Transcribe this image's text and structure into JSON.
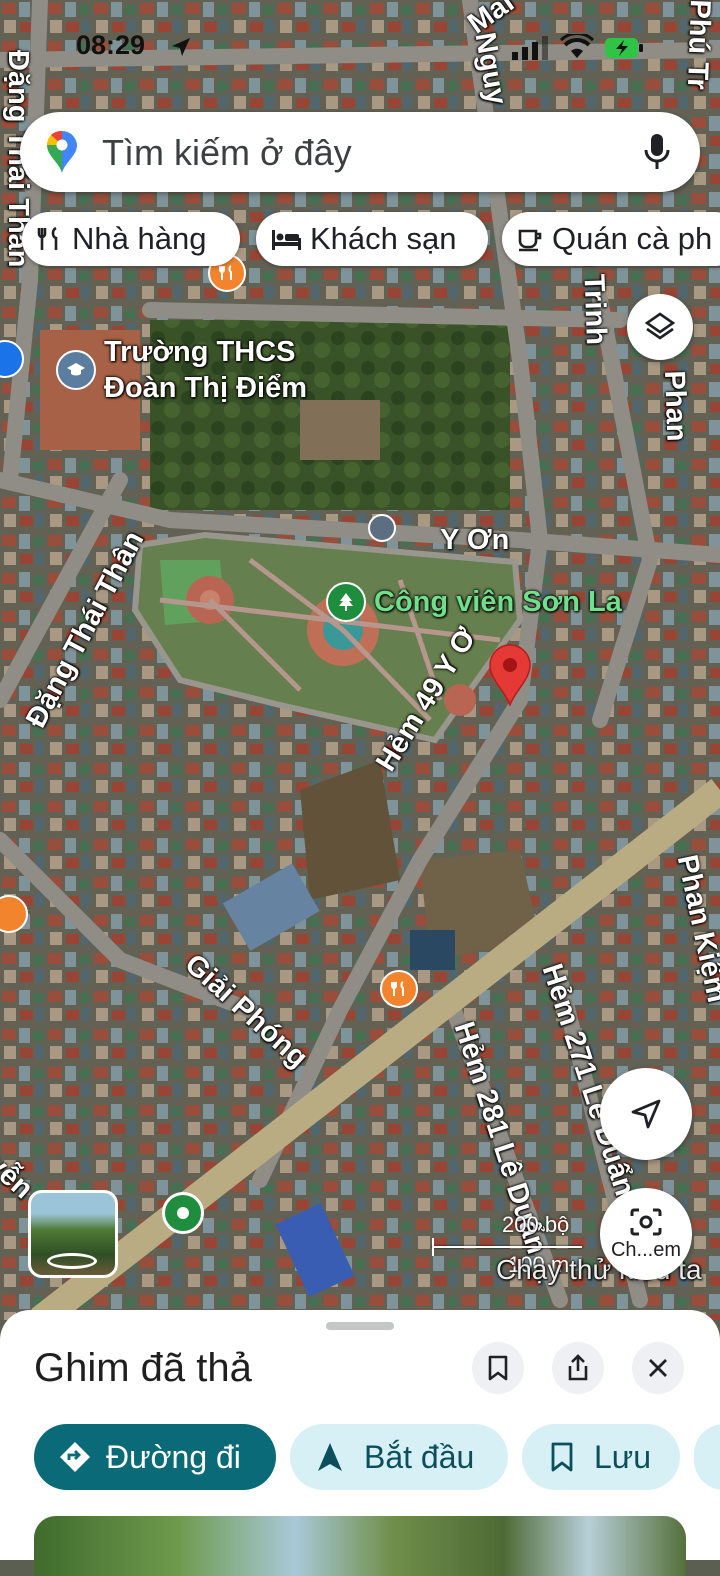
{
  "status": {
    "time": "08:29"
  },
  "search": {
    "placeholder": "Tìm kiếm ở đây"
  },
  "chips": [
    {
      "label": "Nhà hàng",
      "icon": "fork-knife-icon"
    },
    {
      "label": "Khách sạn",
      "icon": "bed-icon"
    },
    {
      "label": "Quán cà ph",
      "icon": "coffee-cup-icon"
    }
  ],
  "map_labels": {
    "school": "Trường THCS\nĐoàn Thị Điểm",
    "park": "Công viên Sơn La",
    "y_on": "Y Ơn",
    "hem49": "Hẻm 49 Y Ơ",
    "giai_phong": "Giải Phóng",
    "dang_thai_than": "Đặng Thái Thân",
    "dang_thai_than_top": "Đặng Thái Thân",
    "nguyen": "Nguy",
    "mai": "Mai",
    "phan_top": "Phan",
    "phu_tr": "Phú Tr",
    "trinh": "nh Trinh",
    "phan_kiem": "Phan Kiệm",
    "hem271": "Hẻm 271 Lê Duẩn",
    "hem281": "Hẻm 281 Lê Duẩn",
    "yen": "yễn",
    "scale_ft": "200 bộ",
    "scale_m": "100 m",
    "test_chip": "Chạy thử kiểu ta"
  },
  "map_controls": {
    "layers_icon": "layers-icon",
    "locate_icon": "navigation-arrow-icon",
    "lens_label": "Ch...em",
    "thumbnail": "street-view-thumbnail"
  },
  "sheet": {
    "title": "Ghim đã thả",
    "actions": [
      {
        "label": "Đường đi",
        "icon": "directions-icon",
        "primary": true
      },
      {
        "label": "Bắt đầu",
        "icon": "start-arrow-icon",
        "primary": false
      },
      {
        "label": "Lưu",
        "icon": "bookmark-icon",
        "primary": false
      }
    ]
  },
  "colors": {
    "pin": "#e53935",
    "primary_button": "#0b6a77",
    "secondary_button_bg": "#d7f0f6",
    "secondary_button_text": "#0b4f5c"
  }
}
